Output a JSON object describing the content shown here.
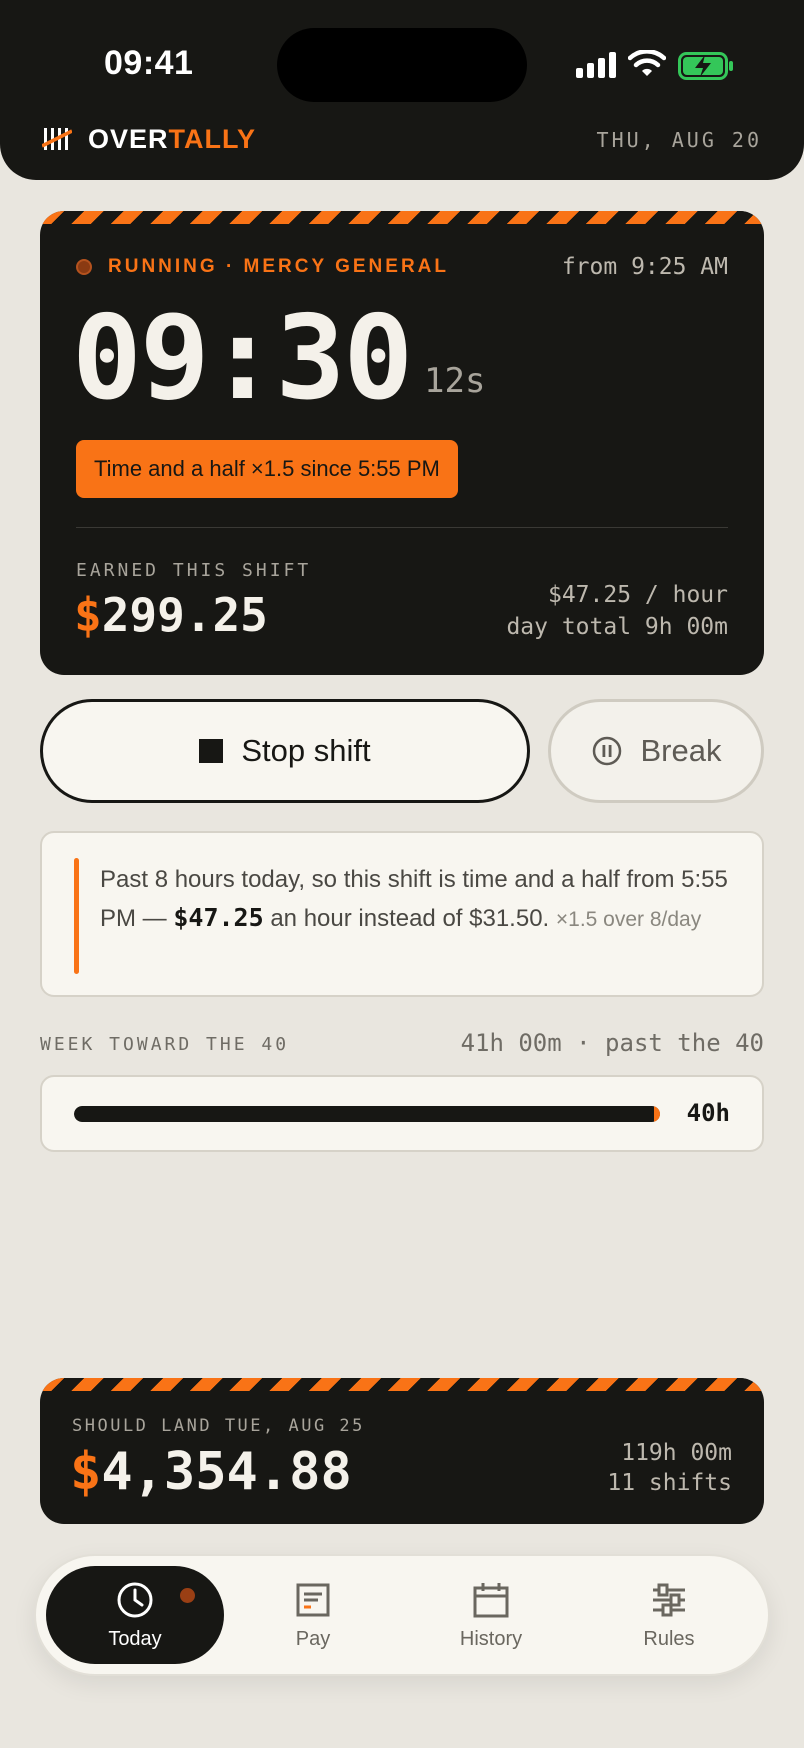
{
  "status_bar": {
    "time": "09:41"
  },
  "header": {
    "brand_a": "OVER",
    "brand_b": "TALLY",
    "date": "THU, AUG 20"
  },
  "shift": {
    "status": "RUNNING · MERCY GENERAL",
    "started": "from 9:25 AM",
    "elapsed": "09:30",
    "seconds": "12s",
    "overtime_badge": "Time and a half ×1.5 since 5:55 PM",
    "earned_label": "EARNED THIS SHIFT",
    "earned_symbol": "$",
    "earned_amount": "299.25",
    "rate": "$47.25 / hour",
    "day_total": "day total 9h 00m"
  },
  "actions": {
    "stop_label": "Stop shift",
    "break_label": "Break"
  },
  "note": {
    "part1": "Past 8 hours today, so this shift is time and a half from 5:55 PM — ",
    "rate": "$47.25",
    "part2": " an hour instead of $31.50. ",
    "rule": "×1.5 over 8/day"
  },
  "week": {
    "label": "WEEK TOWARD THE 40",
    "status": "41h 00m · past the 40",
    "goal": "40h",
    "progress": 1.0
  },
  "payday": {
    "label": "SHOULD LAND TUE, AUG 25",
    "symbol": "$",
    "amount": "4,354.88",
    "hours": "119h 00m",
    "shifts": "11 shifts"
  },
  "tabs": [
    {
      "label": "Today",
      "icon": "clock-icon",
      "active": true
    },
    {
      "label": "Pay",
      "icon": "pay-stub-icon",
      "active": false
    },
    {
      "label": "History",
      "icon": "calendar-icon",
      "active": false
    },
    {
      "label": "Rules",
      "icon": "sliders-icon",
      "active": false
    }
  ],
  "colors": {
    "accent": "#f97316",
    "ink": "#171714",
    "paper": "#e9e6df"
  }
}
